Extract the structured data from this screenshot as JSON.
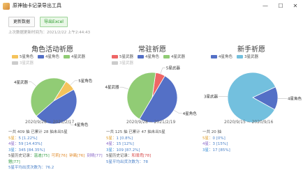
{
  "window": {
    "title": "原神抽卡记录导出工具",
    "minimize": "—",
    "maximize": "☐",
    "close": "✕"
  },
  "toolbar": {
    "update_label": "更新数据",
    "export_label": "导出Excel"
  },
  "last_update": "上次数据更新时间为：2021/2/22 上午2:44:43",
  "colors": {
    "five_star": "#f5c35b",
    "four_star_char": "#5470c6",
    "four_star_weapon": "#91cc75",
    "three_star_weapon": "#cccccc",
    "three_star_weapon_beginner": "#73c0de",
    "five_star_weapon_std": "#ee6666"
  },
  "cards": [
    {
      "title": "角色活动祈愿",
      "legend": [
        "5星角色",
        "4星角色",
        "4星武器",
        "3星武器"
      ],
      "legend_colors": [
        "#f5c35b",
        "#5470c6",
        "#91cc75",
        "#cccccc"
      ],
      "legend_off": [
        false,
        false,
        false,
        true
      ],
      "slice_labels": [
        "5星角色",
        "4星角色",
        "4星武器"
      ],
      "date_range": "2020/9/28 ~ 2021/2/17",
      "total": "一共 409 抽 已累计 28 抽未出5星",
      "rows": [
        {
          "label": "5星：",
          "count": "5",
          "pct": "[1.22%]"
        },
        {
          "label": "4星：",
          "count": "59",
          "pct": "[14.43%]"
        },
        {
          "label": "3星：",
          "count": "345",
          "pct": "[84.35%]"
        }
      ],
      "history_label": "5星历史记录：",
      "history": [
        {
          "name": "温迪[75]",
          "cls": "green"
        },
        {
          "name": "可莉[76]",
          "cls": "orange"
        },
        {
          "name": "钟离[76]",
          "cls": "orange"
        },
        {
          "name": "刻晴[77]",
          "cls": "purple"
        },
        {
          "name": "魈[77]",
          "cls": "green"
        }
      ],
      "average": "5星平均出货次数为：76.2"
    },
    {
      "title": "常驻祈愿",
      "legend": [
        "5星武器",
        "4星角色",
        "4星武器",
        "3星武器"
      ],
      "legend_colors": [
        "#ee6666",
        "#5470c6",
        "#91cc75",
        "#cccccc"
      ],
      "legend_off": [
        false,
        false,
        false,
        true
      ],
      "slice_labels": [
        "5星武器",
        "4星角色",
        "4星武器"
      ],
      "date_range": "2020/9/28 ~ 2021/2/19",
      "total": "一共 125 抽 已累计 47 抽未出5星",
      "rows": [
        {
          "label": "5星：",
          "count": "1",
          "pct": "[0.8%]"
        },
        {
          "label": "4星：",
          "count": "15",
          "pct": "[12%]"
        },
        {
          "label": "3星：",
          "count": "109",
          "pct": "[87.2%]"
        }
      ],
      "history_label": "5星历史记录：",
      "history": [
        {
          "name": "和璞鸢[78]",
          "cls": "red"
        }
      ],
      "average": "5星平均出货次数为：78"
    },
    {
      "title": "新手祈愿",
      "legend": [
        "4星角色",
        "3星武器"
      ],
      "legend_colors": [
        "#5470c6",
        "#73c0de"
      ],
      "legend_off": [
        false,
        false
      ],
      "slice_labels": [
        "4星角色",
        "3星武器"
      ],
      "date_range": "2020/9/15 ~ 2020/9/16",
      "total": "一共 20 抽",
      "rows": [
        {
          "label": "5星：",
          "count": "0",
          "pct": "[0%]"
        },
        {
          "label": "4星：",
          "count": "3",
          "pct": "[15%]"
        },
        {
          "label": "3星：",
          "count": "17",
          "pct": "[85%]"
        }
      ],
      "history_label": "",
      "history": [],
      "average": ""
    }
  ],
  "chart_data": [
    {
      "type": "pie",
      "title": "角色活动祈愿",
      "categories": [
        "5星角色",
        "4星角色",
        "4星武器"
      ],
      "values": [
        5,
        30,
        29
      ],
      "colors": [
        "#f5c35b",
        "#5470c6",
        "#91cc75"
      ]
    },
    {
      "type": "pie",
      "title": "常驻祈愿",
      "categories": [
        "5星武器",
        "4星角色",
        "4星武器"
      ],
      "values": [
        1,
        8,
        7
      ],
      "colors": [
        "#ee6666",
        "#5470c6",
        "#91cc75"
      ]
    },
    {
      "type": "pie",
      "title": "新手祈愿",
      "categories": [
        "4星角色",
        "3星武器"
      ],
      "values": [
        3,
        17
      ],
      "colors": [
        "#5470c6",
        "#73c0de"
      ]
    }
  ]
}
